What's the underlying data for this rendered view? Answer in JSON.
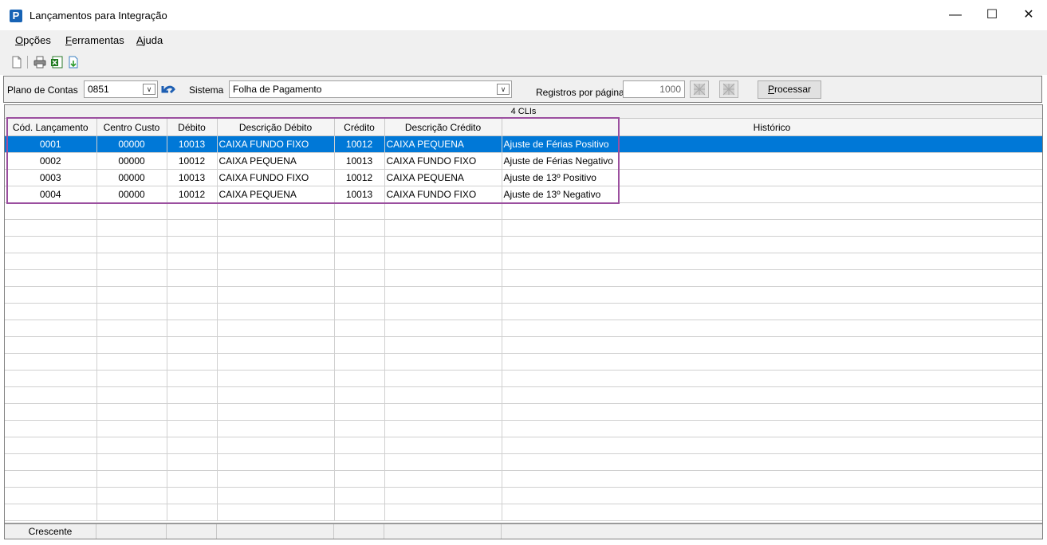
{
  "window": {
    "title": "Lançamentos para Integração",
    "app_icon_letter": "P",
    "minimize": "—",
    "maximize": "☐",
    "close": "✕"
  },
  "menu": [
    {
      "label": "Opções",
      "accel": "O",
      "rest": "pções"
    },
    {
      "label": "Ferramentas",
      "accel": "F",
      "rest": "erramentas"
    },
    {
      "label": "Ajuda",
      "accel": "A",
      "rest": "juda"
    }
  ],
  "toolbar": {
    "icons": [
      "new-document-icon",
      "print-icon",
      "excel-export-icon",
      "export-icon"
    ]
  },
  "filters": {
    "plano_label": "Plano de Contas",
    "plano_value": "0851",
    "sistema_label": "Sistema",
    "sistema_value": "Folha de Pagamento",
    "registros_label": "Registros por páginas:",
    "registros_value": "1000",
    "processar_label": "Processar",
    "processar_accel": "P",
    "processar_rest": "rocessar"
  },
  "grid": {
    "count_text": "4 CLIs",
    "columns": [
      "Cód. Lançamento",
      "Centro Custo",
      "Débito",
      "Descrição Débito",
      "Crédito",
      "Descrição Crédito",
      "Histórico"
    ],
    "rows": [
      [
        "0001",
        "00000",
        "10013",
        "CAIXA FUNDO FIXO",
        "10012",
        "CAIXA PEQUENA",
        "Ajuste de Férias Positivo"
      ],
      [
        "0002",
        "00000",
        "10012",
        "CAIXA PEQUENA",
        "10013",
        "CAIXA FUNDO FIXO",
        "Ajuste de Férias Negativo"
      ],
      [
        "0003",
        "00000",
        "10013",
        "CAIXA FUNDO FIXO",
        "10012",
        "CAIXA PEQUENA",
        "Ajuste de 13º Positivo"
      ],
      [
        "0004",
        "00000",
        "10012",
        "CAIXA PEQUENA",
        "10013",
        "CAIXA FUNDO FIXO",
        "Ajuste de 13º Negativo"
      ]
    ],
    "selected_row": 0,
    "footer_label": "Crescente"
  },
  "colors": {
    "selection": "#0078d7",
    "highlight_box": "#9b4f9f",
    "app_icon": "#1763b5"
  }
}
